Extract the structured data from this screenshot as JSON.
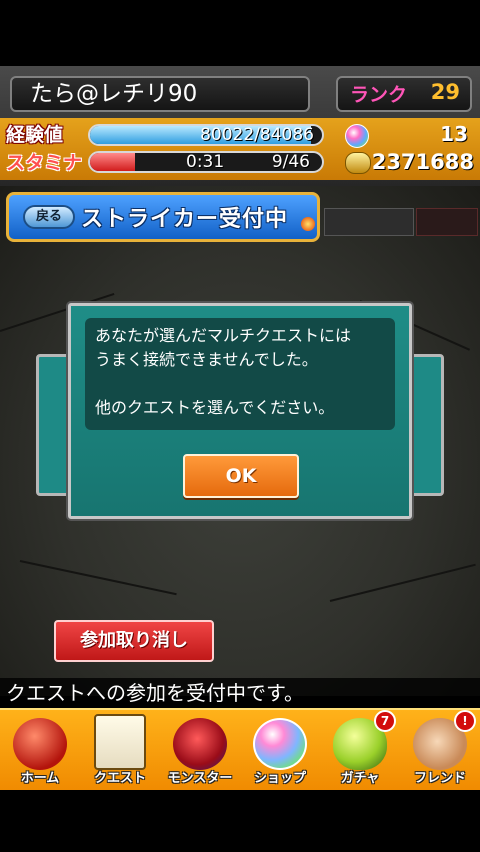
{
  "header": {
    "player_name": "たら@レチリ90",
    "rank_label": "ランク",
    "rank_value": "29"
  },
  "stats": {
    "xp_label": "経験値",
    "xp_value": "80022/84086",
    "xp_fraction": 0.952,
    "stamina_label": "スタミナ",
    "stamina_timer": "0:31",
    "stamina_value": "9/46",
    "stamina_fraction": 0.196,
    "orb_count": "13",
    "coin_count": "2371688"
  },
  "banner": {
    "back_label": "戻る",
    "title": "ストライカー受付中"
  },
  "dialog": {
    "message_line1": "あなたが選んだマルチクエストには",
    "message_line2": "うまく接続できませんでした。",
    "message_line3": "他のクエストを選んでください。",
    "ok_label": "OK"
  },
  "cancel_label": "参加取り消し",
  "status_text": "クエストへの参加を受付中です。",
  "nav": {
    "items": [
      {
        "label": "ホーム",
        "icon": "home-icon"
      },
      {
        "label": "クエスト",
        "icon": "quest-icon"
      },
      {
        "label": "モンスター",
        "icon": "monster-icon"
      },
      {
        "label": "ショップ",
        "icon": "shop-icon"
      },
      {
        "label": "ガチャ",
        "icon": "gacha-icon",
        "badge": "7"
      },
      {
        "label": "フレンド",
        "icon": "friend-icon",
        "badge": "!"
      }
    ]
  },
  "colors": {
    "accent": "#f39a1a",
    "dialog_teal": "#1f8d87",
    "ok_orange": "#ff8a2a",
    "cancel_red": "#e03434"
  }
}
